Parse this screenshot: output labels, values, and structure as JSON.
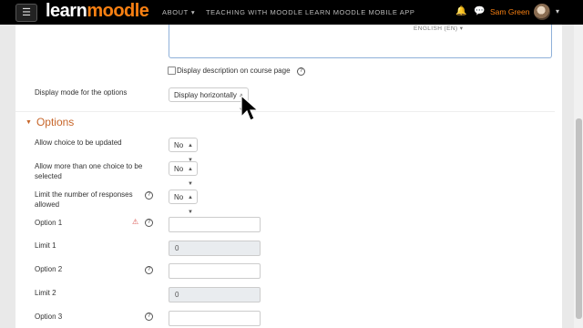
{
  "nav": {
    "logo_learn": "learn",
    "logo_moodle": "moodle",
    "about": "ABOUT",
    "teaching": "TEACHING WITH MOODLE",
    "mobile": "LEARN MOODLE MOBILE APP",
    "user": "Sam Green"
  },
  "editor": {
    "language": "ENGLISH (EN) ▾"
  },
  "display_description": {
    "label": "Display description on course page",
    "checked": false
  },
  "display_mode": {
    "label": "Display mode for the options",
    "value": "Display horizontally"
  },
  "options_section": {
    "title": "Options",
    "allow_update": {
      "label": "Allow choice to be updated",
      "value": "No"
    },
    "allow_multiple": {
      "label_line1": "Allow more than one choice to be",
      "label_line2": "selected",
      "value": "No"
    },
    "limit_responses": {
      "label_line1": "Limit the number of responses",
      "label_line2": "allowed",
      "value": "No"
    },
    "option1": {
      "label": "Option 1",
      "value": ""
    },
    "limit1": {
      "label": "Limit 1",
      "value": "0"
    },
    "option2": {
      "label": "Option 2",
      "value": ""
    },
    "limit2": {
      "label": "Limit 2",
      "value": "0"
    },
    "option3": {
      "label": "Option 3",
      "value": ""
    }
  },
  "colors": {
    "accent": "#f98012",
    "section": "#c7662a",
    "navbar": "#000000"
  },
  "icons": [
    "hamburger-icon",
    "bell-icon",
    "chat-icon",
    "help-icon",
    "required-icon",
    "caret-down-icon",
    "cursor-icon"
  ]
}
